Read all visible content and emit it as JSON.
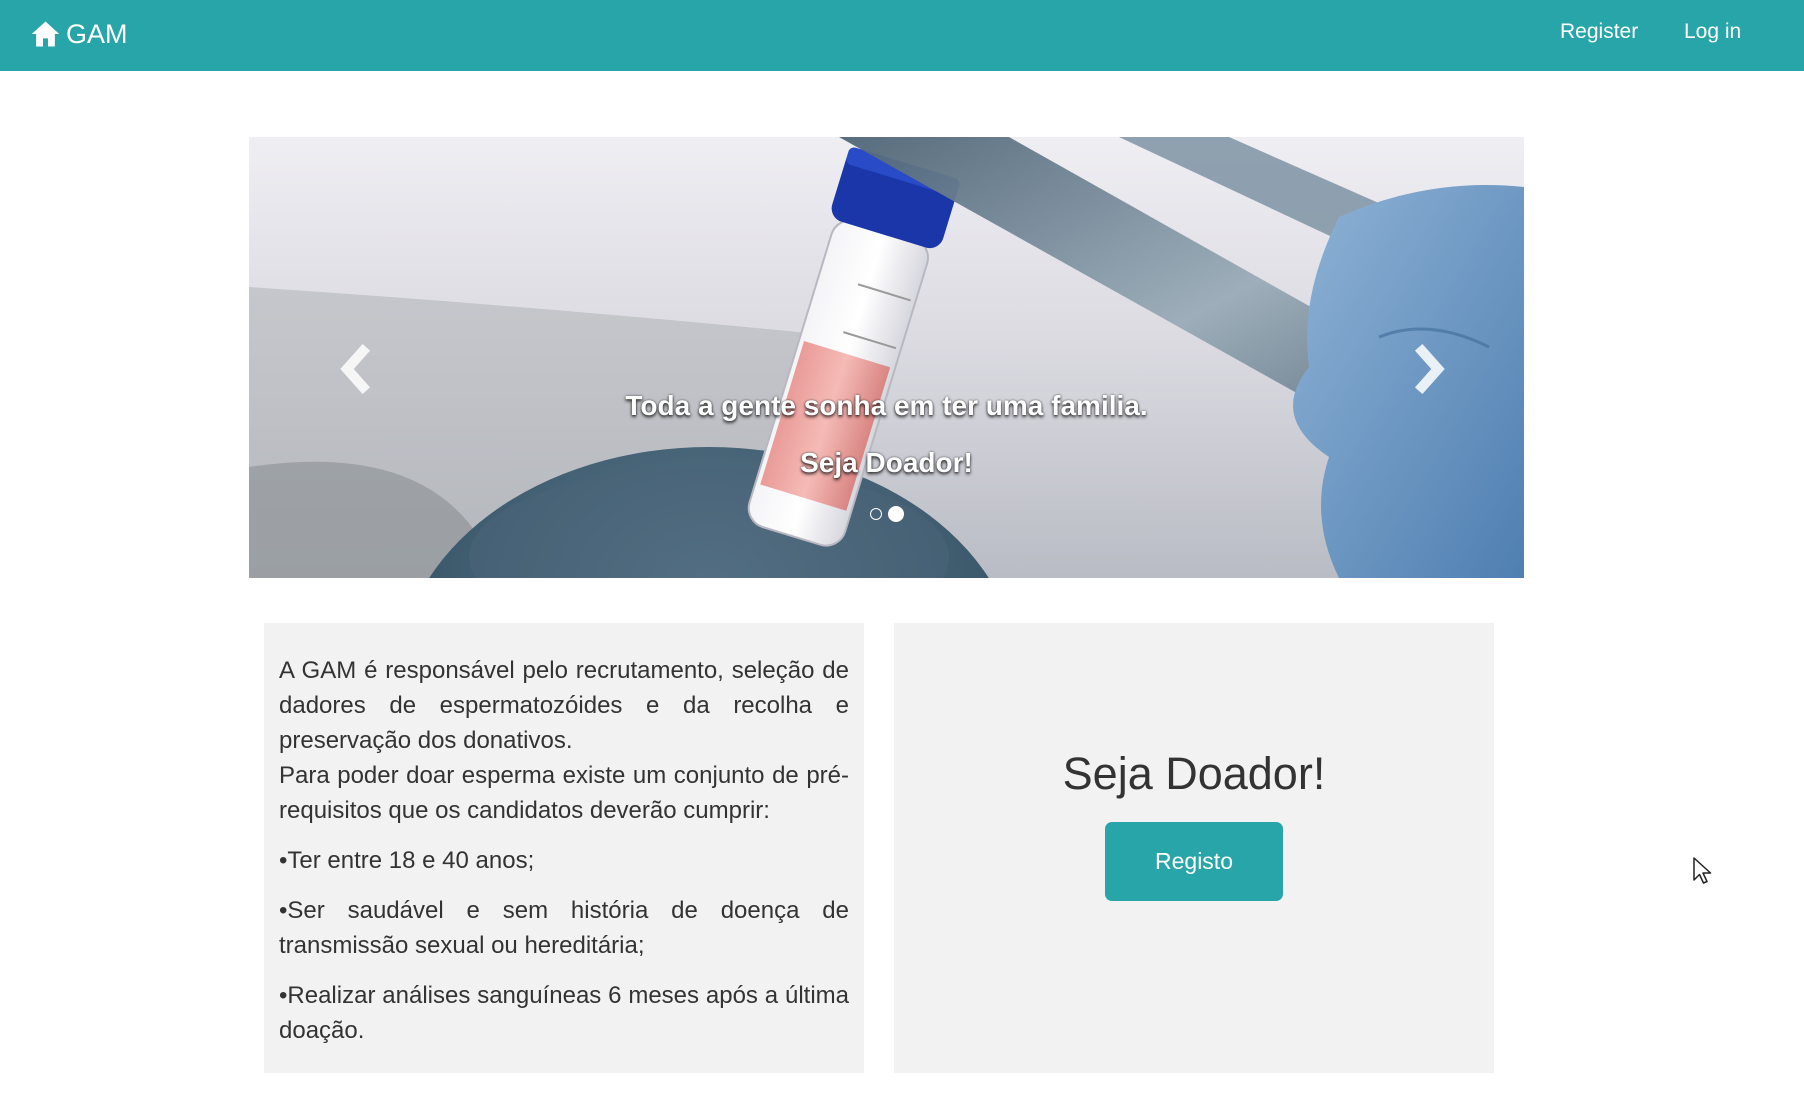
{
  "navbar": {
    "brand": "GAM",
    "brand_icon": "home-icon",
    "links": [
      "Register",
      "Log in"
    ],
    "background": "#28a5a8"
  },
  "carousel": {
    "caption_line1": "Toda a gente sonha em ter uma familia.",
    "caption_line2": "Seja Doador!",
    "slide_count": 2,
    "active_slide": 2,
    "prev_icon": "chevron-left-icon",
    "next_icon": "chevron-right-icon"
  },
  "info": {
    "intro": "A GAM é responsável pelo recrutamento, seleção de dadores de espermatozóides e da recolha e preservação dos donativos.",
    "prereq_intro": "Para poder doar esperma existe um conjunto de pré-requisitos que os candidatos deverão cumprir:",
    "requirements": [
      "•Ter entre 18 e 40 anos;",
      "•Ser saudável e sem história de doença de transmissão sexual ou hereditária;",
      "•Realizar análises sanguíneas 6 meses após a última doação."
    ]
  },
  "donor": {
    "title": "Seja Doador!",
    "button_label": "Registo"
  },
  "colors": {
    "accent": "#28a5a8",
    "panel_bg": "#f2f2f2",
    "text": "#333333"
  }
}
